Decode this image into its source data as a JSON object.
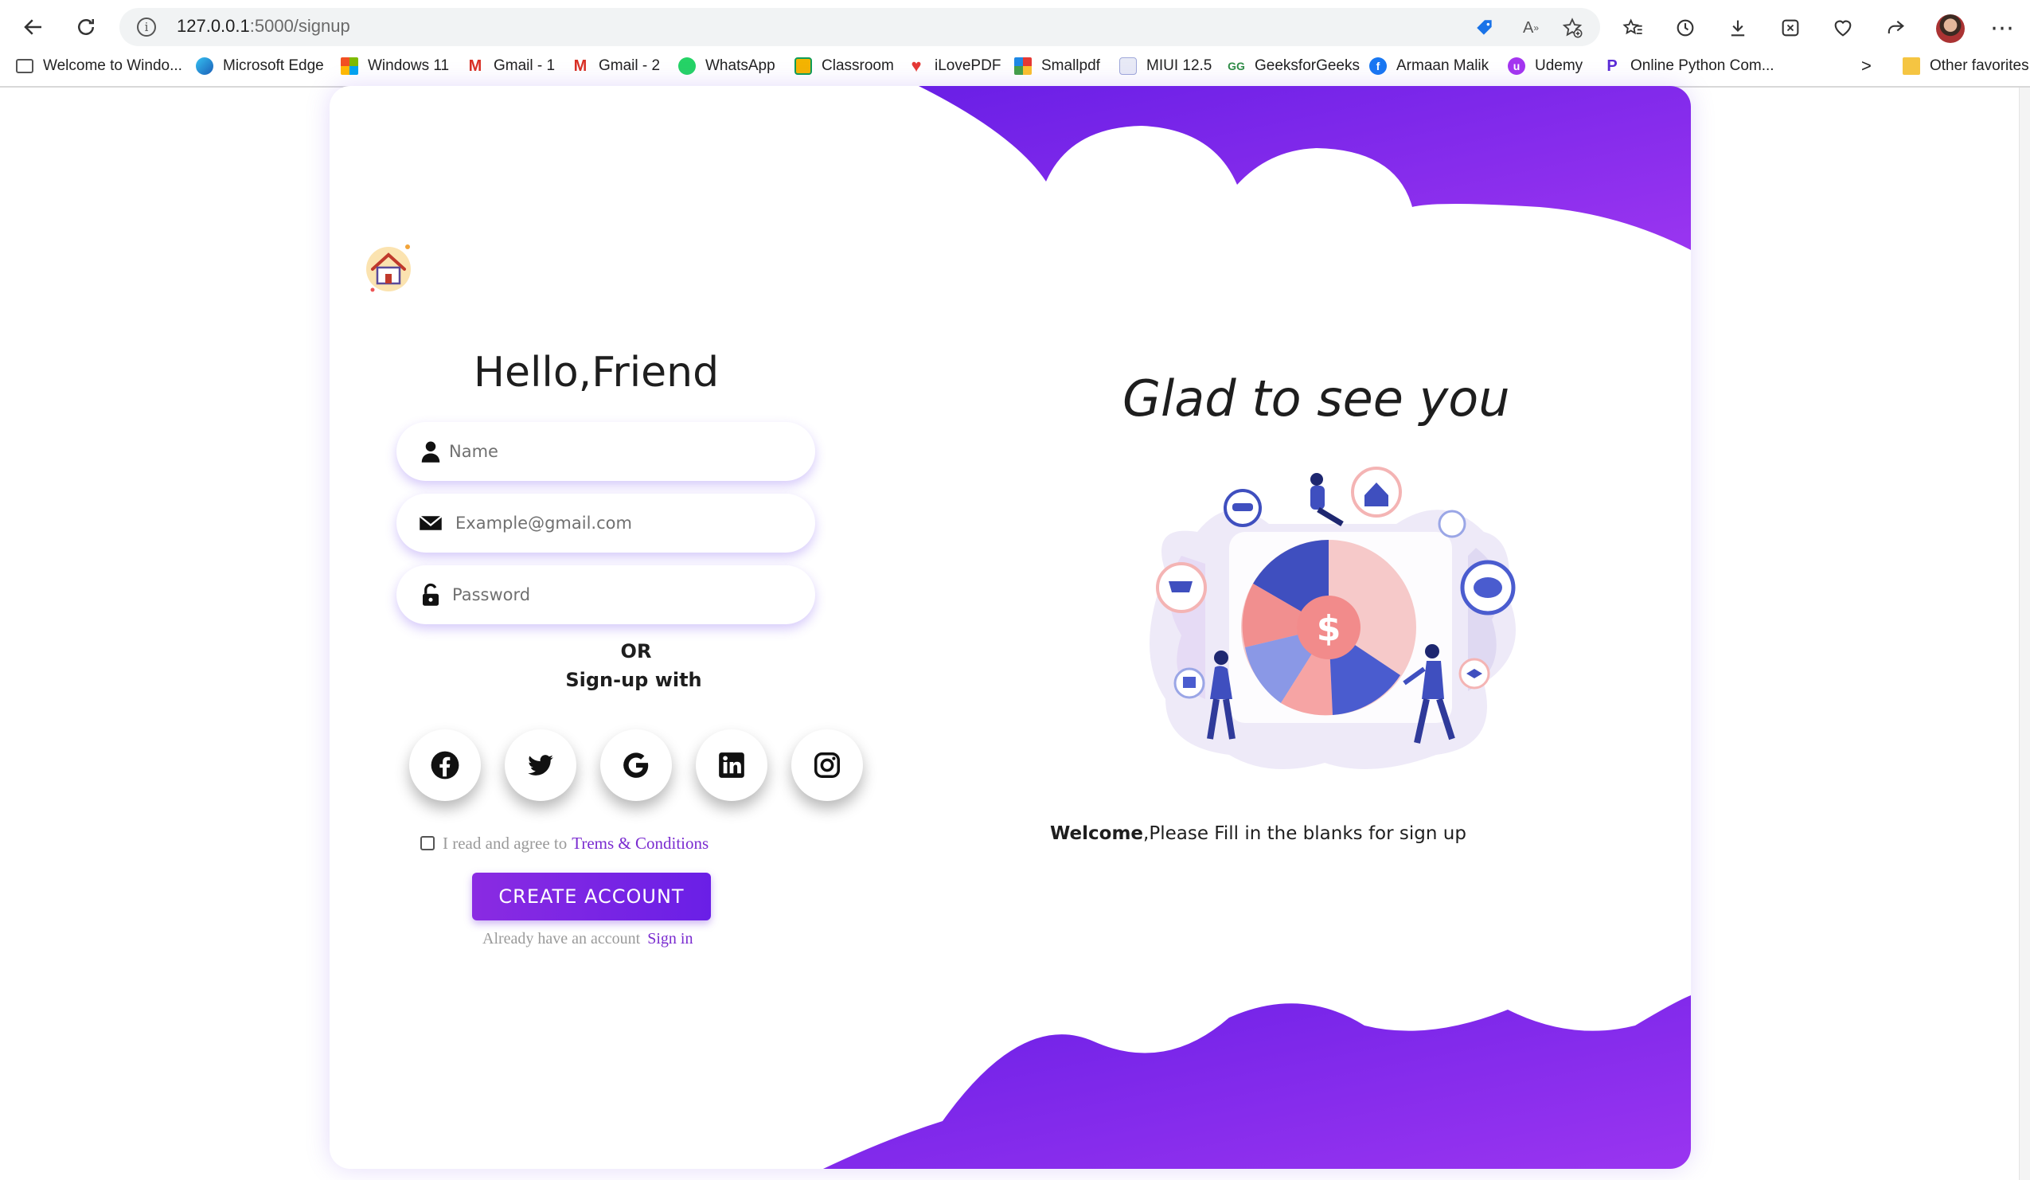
{
  "browser": {
    "url_host": "127.0.0.1",
    "url_path": ":5000/signup",
    "icons": {
      "back": "arrow-left-icon",
      "refresh": "refresh-icon",
      "info": "info-icon",
      "tag": "tag-icon",
      "read_aloud": "read-aloud-icon",
      "favorite_add": "star-add-icon",
      "favorites": "favorites-icon",
      "history": "history-icon",
      "downloads": "download-icon",
      "extensions": "extensions-icon",
      "performance": "heart-pulse-icon",
      "share": "share-icon",
      "more": "more-icon"
    }
  },
  "bookmarks": [
    {
      "label": "Welcome to Windo...",
      "icon": "page-icon",
      "color": "#555555"
    },
    {
      "label": "Microsoft Edge",
      "icon": "edge-icon",
      "color": "#1a8fd8"
    },
    {
      "label": "Windows 11",
      "icon": "windows-icon",
      "color": "#f25022"
    },
    {
      "label": "Gmail - 1",
      "icon": "gmail-icon",
      "color": "#d93025"
    },
    {
      "label": "Gmail - 2",
      "icon": "gmail-icon",
      "color": "#d93025"
    },
    {
      "label": "WhatsApp",
      "icon": "whatsapp-icon",
      "color": "#25d366"
    },
    {
      "label": "Classroom",
      "icon": "classroom-icon",
      "color": "#f4b400"
    },
    {
      "label": "iLovePDF",
      "icon": "heart-icon",
      "color": "#e53935"
    },
    {
      "label": "Smallpdf",
      "icon": "smallpdf-icon",
      "color": "#e65100"
    },
    {
      "label": "MIUI 12.5",
      "icon": "miui-icon",
      "color": "#9fa8da"
    },
    {
      "label": "GeeksforGeeks",
      "icon": "gfg-icon",
      "color": "#2f8d46"
    },
    {
      "label": "Armaan Malik",
      "icon": "facebook-icon",
      "color": "#1877f2"
    },
    {
      "label": "Udemy",
      "icon": "udemy-icon",
      "color": "#a435f0"
    },
    {
      "label": "Online Python Com...",
      "icon": "python-icon",
      "color": "#5b2bd6"
    }
  ],
  "bookmarks_more": ">",
  "other_favorites": "Other favorites",
  "signup": {
    "title": "Hello,Friend",
    "name_placeholder": "Name",
    "email_placeholder": "Example@gmail.com",
    "password_placeholder": "Password",
    "or": "OR",
    "signup_with": "Sign-up with",
    "socials": [
      "facebook-icon",
      "twitter-icon",
      "google-icon",
      "linkedin-icon",
      "instagram-icon"
    ],
    "terms_text": "I read and agree to",
    "terms_link": "Trems & Conditions",
    "create_button": "CREATE ACCOUNT",
    "already_text": "Already have an account",
    "signin_link": "Sign in"
  },
  "welcome": {
    "title": "Glad to see you",
    "bold": "Welcome",
    "text": ",Please Fill in the blanks for sign up"
  },
  "colors": {
    "accent": "#7a2bd0",
    "cloud_gradient_start": "#6a1fe6",
    "cloud_gradient_end": "#9a35f0"
  }
}
